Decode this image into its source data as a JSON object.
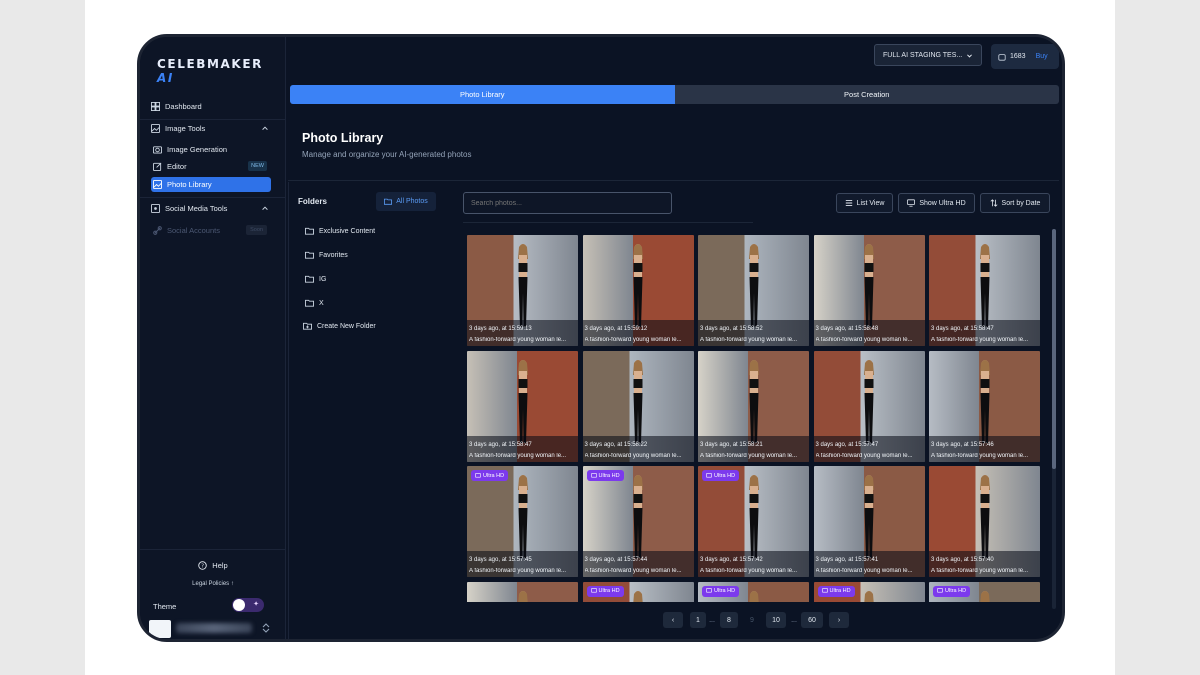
{
  "app": {
    "logo_text": "CELEBMAKER",
    "logo_ai": "AI"
  },
  "sidebar": {
    "dashboard": "Dashboard",
    "image_tools": "Image Tools",
    "image_generation": "Image Generation",
    "editor": "Editor",
    "editor_badge": "NEW",
    "photo_library": "Photo Library",
    "social_media_tools": "Social Media Tools",
    "social_accounts": "Social Accounts",
    "social_badge": "Soon",
    "help": "Help",
    "legal": "Legal Policies ↑",
    "theme": "Theme"
  },
  "topbar": {
    "project": "FULL AI STAGING TES...",
    "credits": "1683",
    "buy": "Buy"
  },
  "tabs": [
    {
      "label": "Photo Library"
    },
    {
      "label": "Post Creation"
    }
  ],
  "header": {
    "title": "Photo Library",
    "subtitle": "Manage and organize your AI-generated photos"
  },
  "folders": {
    "title": "Folders",
    "all_photos": "All Photos",
    "items": [
      "Exclusive Content",
      "Favorites",
      "IG",
      "X"
    ],
    "create": "Create New Folder"
  },
  "toolbar": {
    "search_placeholder": "Search photos...",
    "list_view": "List View",
    "show_ultra_hd": "Show Ultra HD",
    "sort_by_date": "Sort by Date"
  },
  "photos": [
    {
      "time": "3 days ago, at 15:59:13",
      "desc": "A fashion-forward young woman le...",
      "ultra_hd": false
    },
    {
      "time": "3 days ago, at 15:59:12",
      "desc": "A fashion-forward young woman le...",
      "ultra_hd": false
    },
    {
      "time": "3 days ago, at 15:58:52",
      "desc": "A fashion-forward young woman le...",
      "ultra_hd": false
    },
    {
      "time": "3 days ago, at 15:58:48",
      "desc": "A fashion-forward young woman le...",
      "ultra_hd": false
    },
    {
      "time": "3 days ago, at 15:58:47",
      "desc": "A fashion-forward young woman le...",
      "ultra_hd": false
    },
    {
      "time": "3 days ago, at 15:58:47",
      "desc": "A fashion-forward young woman le...",
      "ultra_hd": false
    },
    {
      "time": "3 days ago, at 15:58:22",
      "desc": "A fashion-forward young woman le...",
      "ultra_hd": false
    },
    {
      "time": "3 days ago, at 15:58:21",
      "desc": "A fashion-forward young woman le...",
      "ultra_hd": false
    },
    {
      "time": "3 days ago, at 15:57:47",
      "desc": "A fashion-forward young woman le...",
      "ultra_hd": false
    },
    {
      "time": "3 days ago, at 15:57:46",
      "desc": "A fashion-forward young woman le...",
      "ultra_hd": false
    },
    {
      "time": "3 days ago, at 15:57:45",
      "desc": "A fashion-forward young woman le...",
      "ultra_hd": true
    },
    {
      "time": "3 days ago, at 15:57:44",
      "desc": "A fashion-forward young woman le...",
      "ultra_hd": true
    },
    {
      "time": "3 days ago, at 15:57:42",
      "desc": "A fashion-forward young woman le...",
      "ultra_hd": true
    },
    {
      "time": "3 days ago, at 15:57:41",
      "desc": "A fashion-forward young woman le...",
      "ultra_hd": false
    },
    {
      "time": "3 days ago, at 15:57:40",
      "desc": "A fashion-forward young woman le...",
      "ultra_hd": false
    },
    {
      "time": "",
      "desc": "",
      "ultra_hd": false
    },
    {
      "time": "",
      "desc": "",
      "ultra_hd": true
    },
    {
      "time": "",
      "desc": "",
      "ultra_hd": true
    },
    {
      "time": "",
      "desc": "",
      "ultra_hd": true
    },
    {
      "time": "",
      "desc": "",
      "ultra_hd": true
    }
  ],
  "ultra_hd_label": "Ultra HD",
  "pagination": [
    "‹",
    "1",
    "...",
    "8",
    "9",
    "10",
    "...",
    "60",
    "›"
  ],
  "colors": {
    "accent": "#3b82f6",
    "ultra_hd": "#7c3aed",
    "background": "#0b1324"
  }
}
